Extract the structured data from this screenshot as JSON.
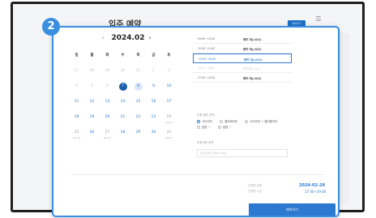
{
  "background": {
    "title": "입주 예약",
    "button_label": "예약하기",
    "icon_label": "메뉴"
  },
  "step": {
    "number": "2"
  },
  "calendar": {
    "month": "2024.02",
    "prev": "‹",
    "next": "›",
    "weekdays": [
      "일",
      "월",
      "화",
      "수",
      "목",
      "금",
      "토"
    ],
    "weeks": [
      [
        {
          "d": "27",
          "k": "dim"
        },
        {
          "d": "28",
          "k": "dim"
        },
        {
          "d": "29",
          "k": "dim"
        },
        {
          "d": "30",
          "k": "dim"
        },
        {
          "d": "31",
          "k": "dim"
        },
        {
          "d": "1",
          "k": "dim"
        },
        {
          "d": "2",
          "k": "dim"
        }
      ],
      [
        {
          "d": "4",
          "k": "dim"
        },
        {
          "d": "5",
          "k": "dim"
        },
        {
          "d": "6",
          "k": "dim"
        },
        {
          "d": "7",
          "k": "sel"
        },
        {
          "d": "8",
          "k": "hov"
        },
        {
          "d": "9",
          "k": "avail"
        },
        {
          "d": "10",
          "k": "avail"
        }
      ],
      [
        {
          "d": "11",
          "k": "avail"
        },
        {
          "d": "12",
          "k": "avail"
        },
        {
          "d": "13",
          "k": "avail"
        },
        {
          "d": "14",
          "k": "avail"
        },
        {
          "d": "15",
          "k": "avail"
        },
        {
          "d": "16",
          "k": "avail"
        },
        {
          "d": "17",
          "k": "avail"
        }
      ],
      [
        {
          "d": "18",
          "k": "avail"
        },
        {
          "d": "19",
          "k": "avail"
        },
        {
          "d": "20",
          "k": "avail"
        },
        {
          "d": "21",
          "k": "avail"
        },
        {
          "d": "22",
          "k": "avail"
        },
        {
          "d": "23",
          "k": "avail"
        },
        {
          "d": "24",
          "k": "plain",
          "sub": "예약마감"
        }
      ],
      [
        {
          "d": "25",
          "k": "plain",
          "sub": "예약마감"
        },
        {
          "d": "26",
          "k": "avail"
        },
        {
          "d": "27",
          "k": "plain",
          "sub": "예약마감"
        },
        {
          "d": "28",
          "k": "avail"
        },
        {
          "d": "29",
          "k": "avail"
        },
        {
          "d": "30",
          "k": "avail"
        },
        {
          "d": "31",
          "k": "plain",
          "sub": "예약마감"
        }
      ]
    ]
  },
  "slots": [
    {
      "time": "09:00~12:00",
      "status": "예약 가능 (0/1)",
      "state": "normal"
    },
    {
      "time": "12:00~15:00",
      "status": "예약 가능 (0/1)",
      "state": "normal"
    },
    {
      "time": "13:00~16:00",
      "status": "예약 가능 (0/1)",
      "state": "active"
    },
    {
      "time": "15:00~18:00",
      "status": "예약마감 (1/1)",
      "state": "off"
    },
    {
      "time": "17:00~19:00",
      "status": "예약 가능 (0/1)",
      "state": "normal"
    }
  ],
  "options": {
    "label": "이용 옵션 선택",
    "row1": [
      "사다리차",
      "엘리베이터",
      "사다리차 + 엘리베이터"
    ],
    "row2": [
      "없음 ㅡ",
      "없음 ㅡ"
    ]
  },
  "memo": {
    "label": "요청사항 입력",
    "placeholder": "요청사항을 입력해 주세요"
  },
  "summary": {
    "date_label": "선택한 날짜",
    "time_label": "선택한 시간",
    "date": "2024-02-29",
    "time": "17:00~19:00"
  },
  "confirm_label": "예약하기",
  "colors": {
    "accent": "#2b79d0",
    "badge": "#3a8fe0",
    "selected_day": "#1d5fae"
  }
}
